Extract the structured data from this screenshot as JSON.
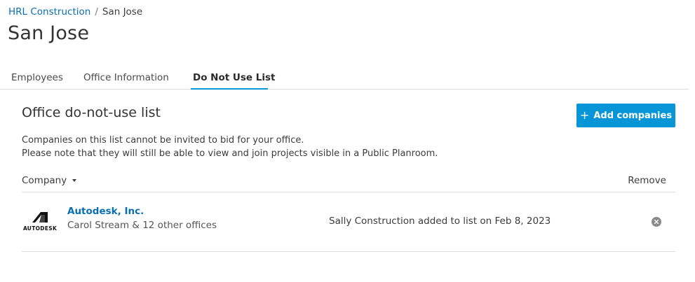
{
  "breadcrumb": {
    "parent": "HRL Construction",
    "separator": "/",
    "current": "San Jose"
  },
  "page_title": "San Jose",
  "tabs": [
    {
      "label": "Employees",
      "active": false
    },
    {
      "label": "Office Information",
      "active": false
    },
    {
      "label": "Do Not Use List",
      "active": true
    }
  ],
  "section": {
    "title": "Office do-not-use list",
    "add_button_label": "Add companies",
    "description_line1": "Companies on this list cannot be invited to bid for your office.",
    "description_line2": "Please note that they will still be able to view and join projects visible in a Public Planroom."
  },
  "table": {
    "columns": {
      "company": "Company",
      "remove": "Remove"
    },
    "rows": [
      {
        "logo_text": "AUTODESK",
        "company_name": "Autodesk, Inc.",
        "company_sub": "Carol Stream & 12 other offices",
        "added_text": "Sally Construction added to list on Feb 8, 2023"
      }
    ]
  },
  "colors": {
    "accent": "#0696d7",
    "link": "#0a6fb0",
    "divider": "#dcdcdc",
    "remove_icon": "#8a8a8a"
  }
}
